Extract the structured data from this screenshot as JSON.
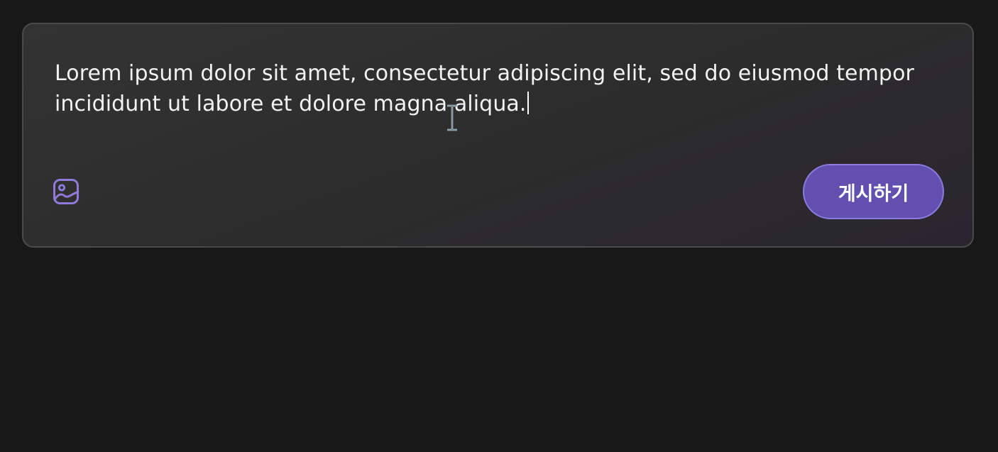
{
  "composer": {
    "text": "Lorem ipsum dolor sit amet, consectetur adipiscing elit, sed do eiusmod tempor incididunt ut labore et dolore magna aliqua.",
    "post_button_label": "게시하기"
  },
  "icons": {
    "attach": "image-icon",
    "cursor": "text-cursor-icon"
  },
  "colors": {
    "accent": "#6250b0",
    "accent_border": "#8b7be0",
    "icon": "#8d7ad9",
    "background": "#181818",
    "card": "#2f2f2f"
  }
}
